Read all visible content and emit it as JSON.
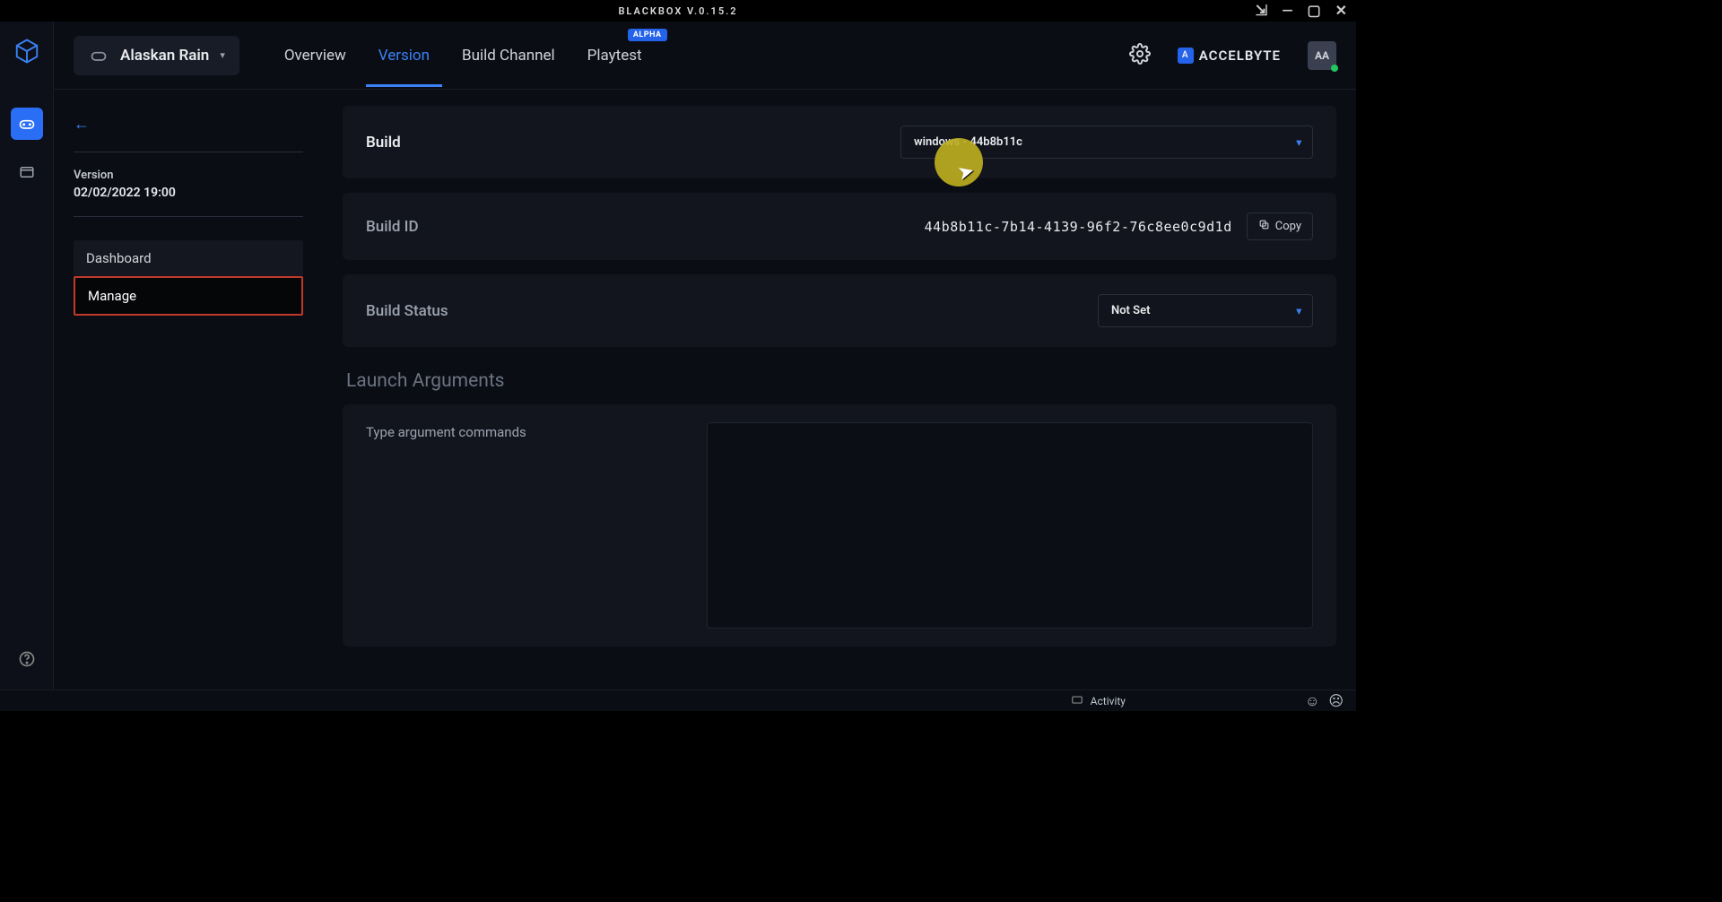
{
  "titlebar": {
    "title": "BLACKBOX V.0.15.2"
  },
  "project": {
    "name": "Alaskan Rain"
  },
  "tabs": {
    "overview": "Overview",
    "version": "Version",
    "build_channel": "Build Channel",
    "playtest": "Playtest",
    "playtest_badge": "ALPHA"
  },
  "brand": {
    "name": "ACCELBYTE"
  },
  "avatar": {
    "initials": "AA"
  },
  "sidepanel": {
    "version_label": "Version",
    "version_date": "02/02/2022 19:00",
    "items": {
      "dashboard": "Dashboard",
      "manage": "Manage"
    }
  },
  "build": {
    "label": "Build",
    "selected": "windows - 44b8b11c"
  },
  "build_id": {
    "label": "Build ID",
    "value": "44b8b11c-7b14-4139-96f2-76c8ee0c9d1d",
    "copy_label": "Copy"
  },
  "build_status": {
    "label": "Build Status",
    "selected": "Not Set"
  },
  "launch_args": {
    "heading": "Launch Arguments",
    "placeholder": "Type argument commands"
  },
  "statusbar": {
    "activity": "Activity"
  }
}
